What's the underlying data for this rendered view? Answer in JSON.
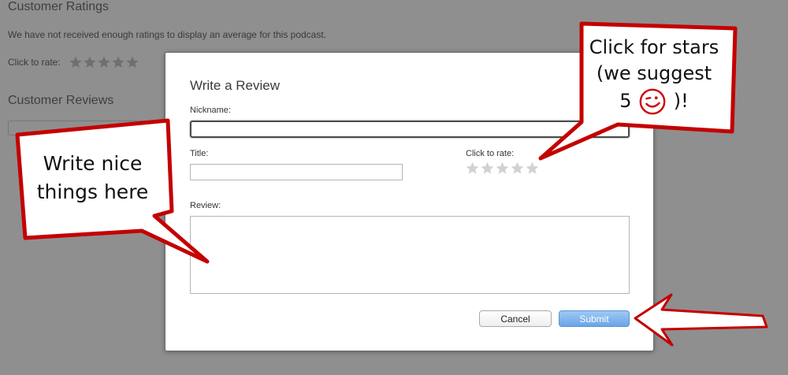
{
  "background": {
    "ratings_title": "Customer Ratings",
    "ratings_message": "We have not received enough ratings to display an average for this podcast.",
    "click_to_rate": "Click to rate:",
    "reviews_title": "Customer Reviews",
    "star_count": 5
  },
  "dialog": {
    "title": "Write a Review",
    "nickname_label": "Nickname:",
    "nickname_value": "",
    "title_label": "Title:",
    "title_value": "",
    "rate_label": "Click to rate:",
    "rating": 0,
    "review_label": "Review:",
    "review_value": "",
    "cancel_label": "Cancel",
    "submit_label": "Submit"
  },
  "annotations": {
    "left_bubble": [
      "Write nice",
      "things here"
    ],
    "right_bubble_line1": "Click for stars",
    "right_bubble_line2": "(we suggest",
    "right_bubble_line3_pre": "5",
    "right_bubble_line3_post": ")!",
    "accent_color": "#cc0000",
    "wink_icon": "winking-smiley-icon"
  }
}
